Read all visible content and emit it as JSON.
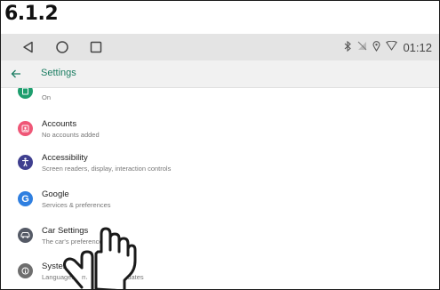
{
  "caption": "6.1.2",
  "statusbar": {
    "time": "01:12",
    "icons": [
      "bluetooth-icon",
      "signal-off-icon",
      "location-icon",
      "wifi-icon"
    ]
  },
  "nav": {
    "icons": [
      "back-triangle-icon",
      "home-circle-icon",
      "recents-square-icon"
    ]
  },
  "appbar": {
    "title": "Settings",
    "back_icon": "arrow-left-icon"
  },
  "colors": {
    "accent": "#1b7d62",
    "statusbar": "#e4e4e4",
    "appbar": "#f1f1f1"
  },
  "settings": [
    {
      "title": "",
      "subtitle": "On",
      "icon": "display-icon",
      "color": "#1e9e6e"
    },
    {
      "title": "Accounts",
      "subtitle": "No accounts added",
      "icon": "account-icon",
      "color": "#ef5777"
    },
    {
      "title": "Accessibility",
      "subtitle": "Screen readers, display, interaction controls",
      "icon": "accessibility-icon",
      "color": "#3f3f8f"
    },
    {
      "title": "Google",
      "subtitle": "Services & preferences",
      "icon": "google-icon",
      "color": "#2f7fe0"
    },
    {
      "title": "Car Settings",
      "subtitle": "The car's preference",
      "icon": "car-icon",
      "color": "#555a66"
    },
    {
      "title": "System",
      "subtitle": "Languages, time, backup, updates",
      "icon": "info-icon",
      "color": "#6e6e6e"
    }
  ]
}
